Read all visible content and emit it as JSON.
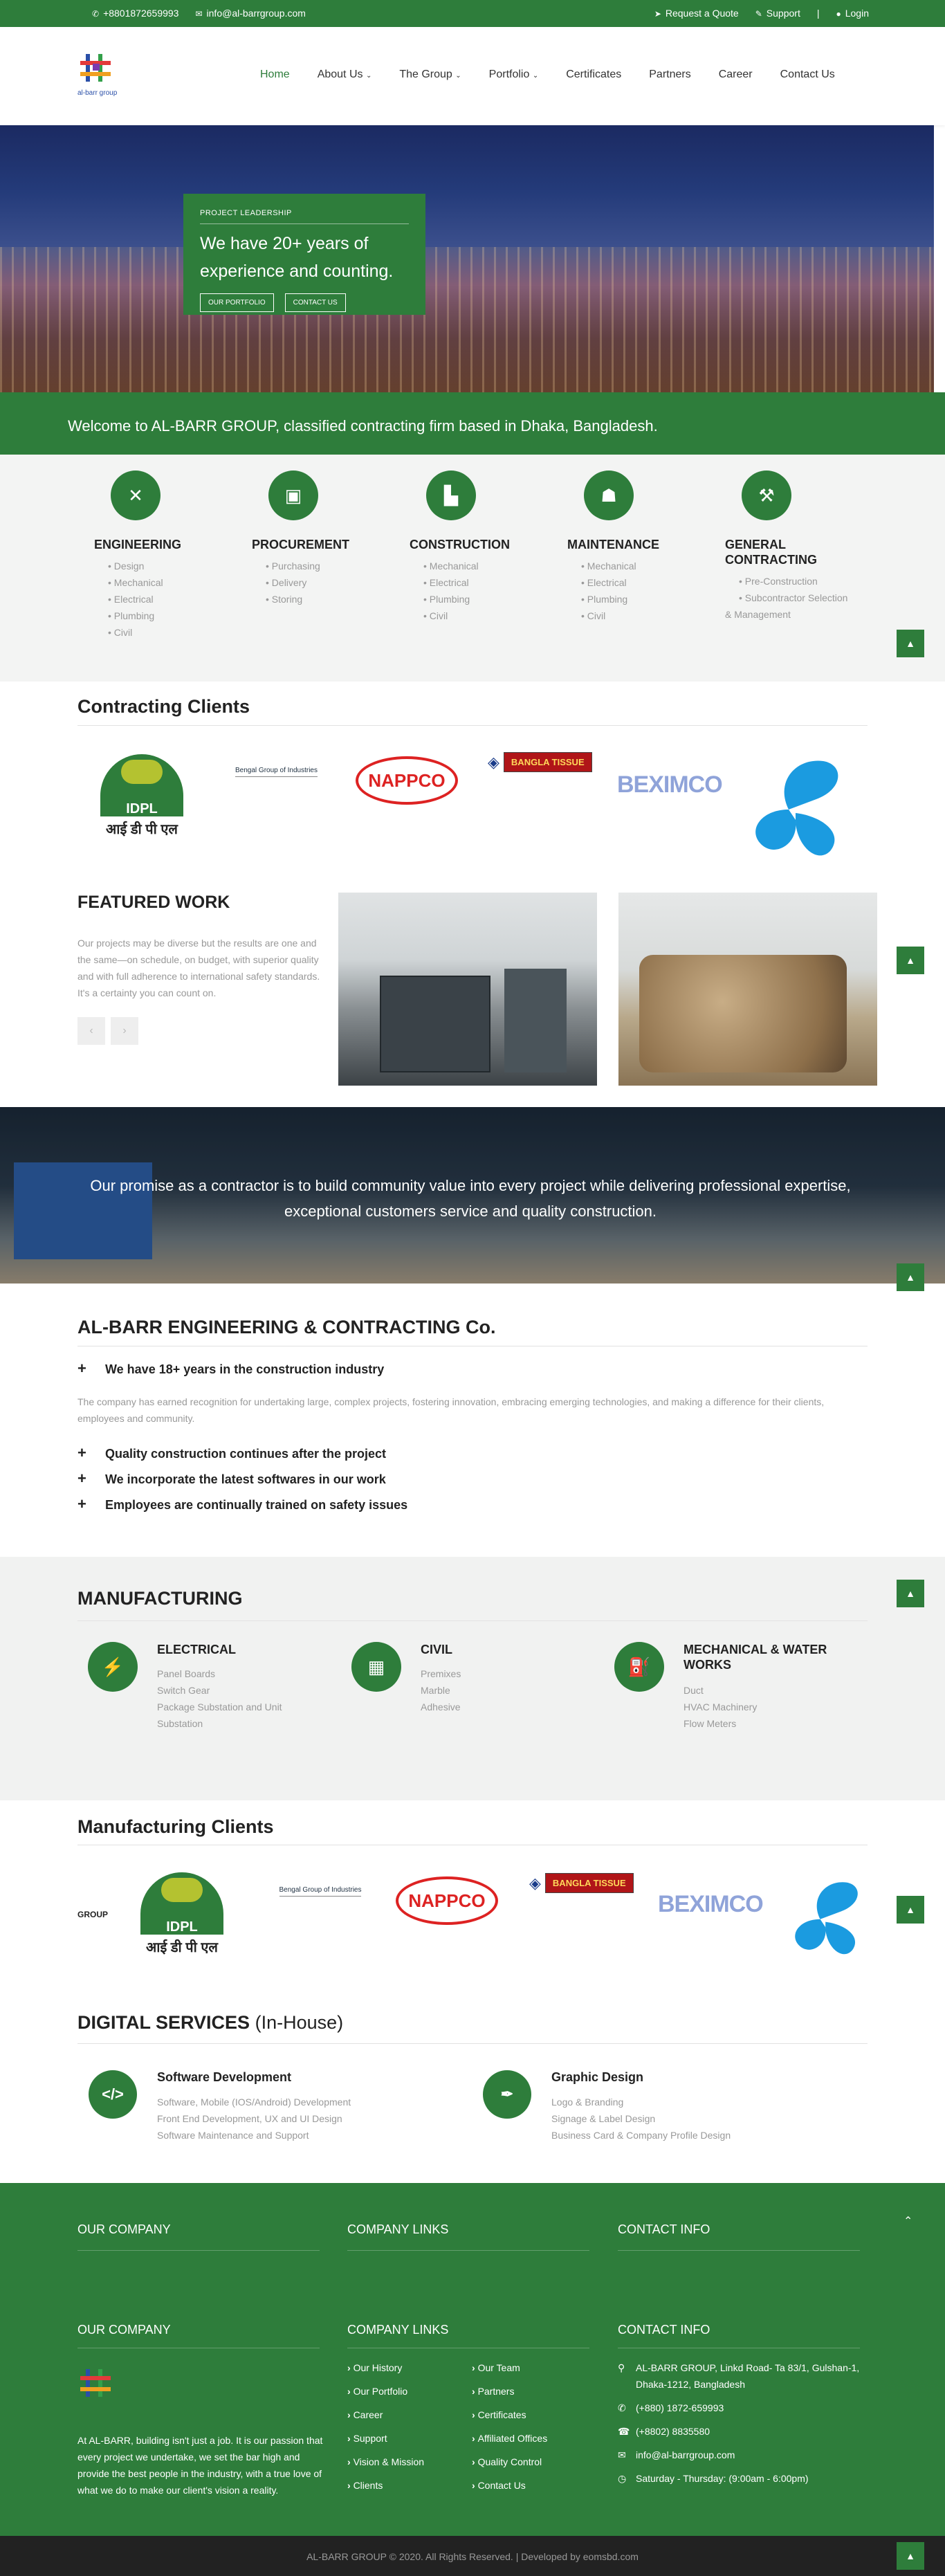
{
  "topbar": {
    "phone": "+8801872659993",
    "email": "info@al-barrgroup.com",
    "request_quote": "Request a Quote",
    "support": "Support",
    "separator": "|",
    "login": "Login"
  },
  "header": {
    "logo_text": "al-barr group",
    "nav": [
      "Home",
      "About Us",
      "The Group",
      "Portfolio",
      "Certificates",
      "Partners",
      "Career",
      "Contact Us"
    ]
  },
  "hero": {
    "kicker": "PROJECT LEADERSHIP",
    "headline": "We have 20+ years of experience and counting.",
    "btn_portfolio": "OUR PORTFOLIO",
    "btn_contact": "CONTACT US"
  },
  "welcome": "Welcome to AL-BARR GROUP, classified contracting firm based in Dhaka, Bangladesh.",
  "services": [
    {
      "title": "ENGINEERING",
      "items": [
        "Design",
        "Mechanical",
        "Electrical",
        "Plumbing",
        "Civil"
      ]
    },
    {
      "title": "PROCUREMENT",
      "items": [
        "Purchasing",
        "Delivery",
        "Storing"
      ]
    },
    {
      "title": "CONSTRUCTION",
      "items": [
        "Mechanical",
        "Electrical",
        "Plumbing",
        "Civil"
      ]
    },
    {
      "title": "MAINTENANCE",
      "items": [
        "Mechanical",
        "Electrical",
        "Plumbing",
        "Civil"
      ]
    },
    {
      "title": "GENERAL CONTRACTING",
      "items": [
        "Pre-Construction",
        "Subcontractor Selection & Management"
      ]
    }
  ],
  "contracting_clients": {
    "title": "Contracting Clients",
    "idpl_text": "IDPL",
    "idpl_hindi": "आई डी पी एल",
    "bengal": "Bengal Group of Industries",
    "nappco": "NAPPCO",
    "bangla_tissue": "BANGLA TISSUE",
    "beximco": "BEXIMCO"
  },
  "featured": {
    "title": "FEATURED WORK",
    "text": "Our projects may be diverse but the results are one and the same—on schedule, on budget, with superior quality and with full adherence to international safety standards. It's a certainty you can count on."
  },
  "promise": "Our promise as a contractor is to build community value into every project while delivering professional expertise, exceptional customers service and quality construction.",
  "albarr": {
    "title": "AL-BARR ENGINEERING & CONTRACTING Co.",
    "point1": "We have 18+ years in the construction industry",
    "paragraph": "The company has earned recognition for undertaking large, complex projects, fostering innovation, embracing emerging technologies, and making a difference for their clients, employees and community.",
    "point2": "Quality construction continues after the project",
    "point3": "We incorporate the latest softwares in our work",
    "point4": "Employees are continually trained on safety issues"
  },
  "manufacturing": {
    "title": "MANUFACTURING",
    "items": [
      {
        "title": "ELECTRICAL",
        "items": [
          "Panel Boards",
          "Switch Gear",
          "Package Substation and Unit Substation"
        ]
      },
      {
        "title": "CIVIL",
        "items": [
          "Premixes",
          "Marble",
          "Adhesive"
        ]
      },
      {
        "title": "MECHANICAL & WATER WORKS",
        "items": [
          "Duct",
          "HVAC Machinery",
          "Flow Meters"
        ]
      }
    ]
  },
  "manufacturing_clients": {
    "title": "Manufacturing Clients",
    "partial_left": "GROUP"
  },
  "digital": {
    "title_bold": "DIGITAL SERVICES",
    "title_normal": "(In-House)",
    "items": [
      {
        "title": "Software Development",
        "lines": [
          "Software, Mobile (IOS/Android) Development",
          "Front End Development, UX and UI Design",
          "Software Maintenance and Support"
        ]
      },
      {
        "title": "Graphic Design",
        "lines": [
          "Logo & Branding",
          "Signage & Label Design",
          "Business Card & Company Profile Design"
        ]
      }
    ]
  },
  "footer": {
    "our_company": "OUR COMPANY",
    "company_links": "COMPANY LINKS",
    "contact_info": "CONTACT INFO",
    "about": "At AL-BARR, building isn't just a job. It is our passion that every project we undertake, we set the bar high and provide the best people in the industry, with a true love of what we do to make our client's vision a reality.",
    "links_left": [
      "Our History",
      "Our Portfolio",
      "Career",
      "Support",
      "Vision & Mission",
      "Clients"
    ],
    "links_right": [
      "Our Team",
      "Partners",
      "Certificates",
      "Affiliated Offices",
      "Quality Control",
      "Contact Us"
    ],
    "address": "AL-BARR GROUP, Linkd Road- Ta 83/1, Gulshan-1, Dhaka-1212, Bangladesh",
    "mobile": "(+880) 1872-659993",
    "tel": "(+8802) 8835580",
    "email": "info@al-barrgroup.com",
    "hours": "Saturday - Thursday: (9:00am - 6:00pm)",
    "copyright": "AL-BARR GROUP © 2020. All Rights Reserved. | Developed by eomsbd.com"
  },
  "icons": {
    "phone": "phone-icon",
    "mail": "mail-icon",
    "quote": "paper-plane-icon",
    "support": "support-icon",
    "user": "user-icon",
    "chevron": "chevron-down-icon",
    "chevron_up": "chevron-up-icon"
  },
  "colors": {
    "primary": "#2e7d3b"
  }
}
